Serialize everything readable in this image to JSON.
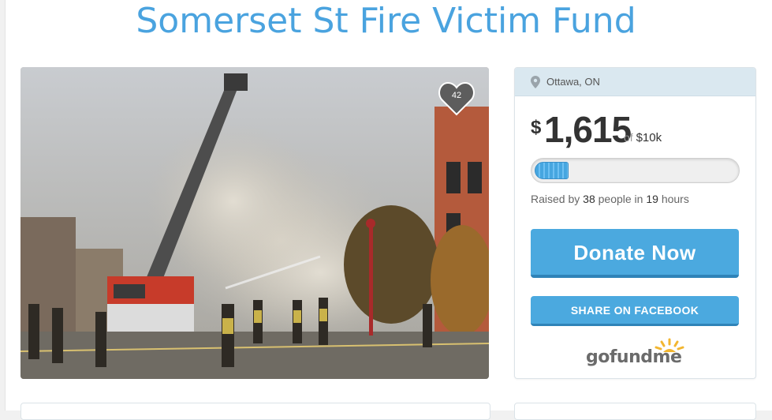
{
  "campaign": {
    "title": "Somerset St Fire Victim Fund"
  },
  "photo": {
    "heart_count": "42"
  },
  "sidebar": {
    "location": "Ottawa, ON",
    "currency_symbol": "$",
    "amount_raised": "1,615",
    "goal_prefix": "of",
    "goal": "$10k",
    "progress_fraction": 0.1615,
    "raised_prefix": "Raised by",
    "people_count": "38",
    "people_label": "people in",
    "hours_count": "19",
    "hours_label": "hours",
    "donate_label": "Donate Now",
    "share_label": "SHARE ON FACEBOOK",
    "logo_text_a": "gofund",
    "logo_text_b": "me"
  },
  "colors": {
    "accent": "#4aa3df",
    "button": "#4ba9df",
    "button_shadow": "#2f83b8"
  },
  "icons": {
    "location": "map-pin-icon",
    "favorite": "heart-icon",
    "logo": "sun-icon"
  }
}
